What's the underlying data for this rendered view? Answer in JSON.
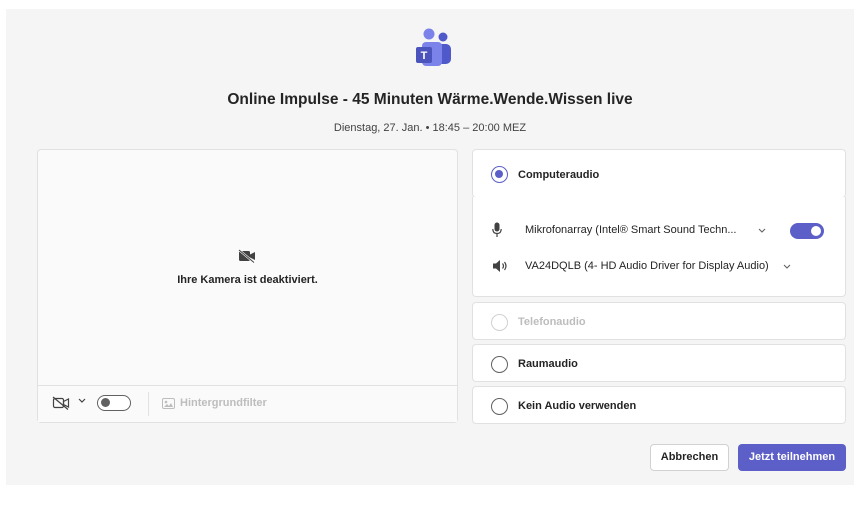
{
  "app": {
    "logo_icon": "teams-logo-icon",
    "accent": "#5b5fc7"
  },
  "meeting": {
    "title": "Online Impulse - 45 Minuten Wärme.Wende.Wissen live",
    "time": "Dienstag, 27. Jan. • 18:45 – 20:00 MEZ"
  },
  "camera": {
    "status_text": "Ihre Kamera ist deaktiviert.",
    "toggle_on": false,
    "background_filter_label": "Hintergrundfilter"
  },
  "audio": {
    "computer_audio_label": "Computeraudio",
    "microphone": {
      "name": "Mikrofonarray (Intel® Smart Sound Techn...",
      "enabled": true
    },
    "speaker": {
      "name": "VA24DQLB (4- HD Audio Driver for Display Audio)"
    },
    "phone_audio_label": "Telefonaudio",
    "room_audio_label": "Raumaudio",
    "no_audio_label": "Kein Audio verwenden",
    "selected": "Computeraudio"
  },
  "actions": {
    "cancel_label": "Abbrechen",
    "join_label": "Jetzt teilnehmen"
  }
}
